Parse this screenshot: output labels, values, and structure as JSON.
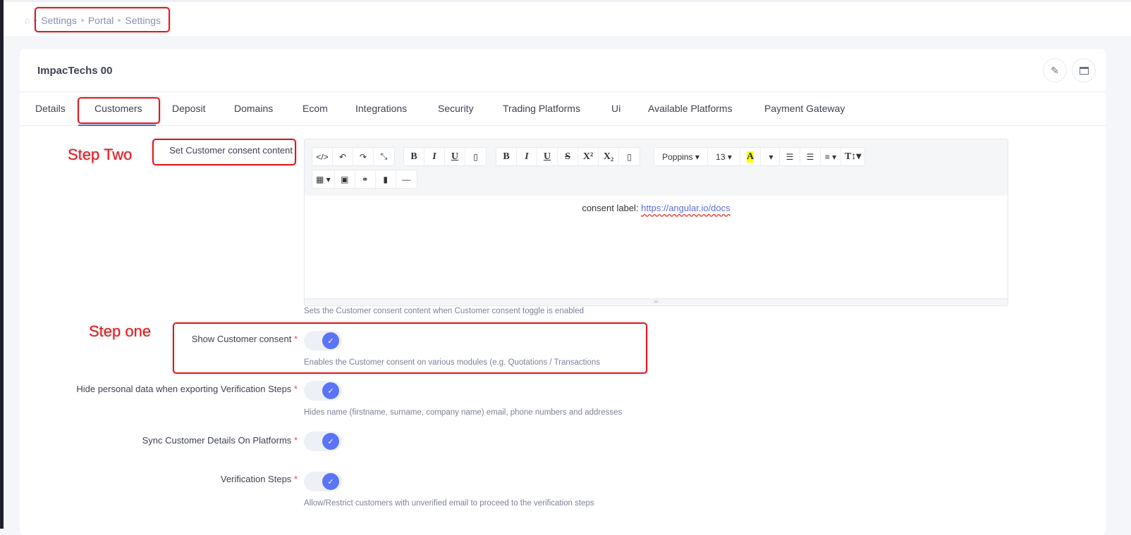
{
  "breadcrumb": [
    "Settings",
    "Portal",
    "Settings"
  ],
  "title": "ImpacTechs 00",
  "tabs": [
    "Details",
    "Customers",
    "Deposit",
    "Domains",
    "Ecom",
    "Integrations",
    "Security",
    "Trading Platforms",
    "Ui",
    "Available Platforms",
    "Payment Gateway"
  ],
  "active_tab": "Customers",
  "annotations": {
    "step_two": "Step Two",
    "step_one": "Step one"
  },
  "editor": {
    "label": "Set Customer consent content",
    "font": "Poppins",
    "size": "13",
    "content_prefix": "consent label: ",
    "content_link": "https://angular.io/docs",
    "help": "Sets the Customer consent content when Customer consent toggle is enabled"
  },
  "settings": [
    {
      "label": "Show Customer consent",
      "enabled": true,
      "help": "Enables the Customer consent on various modules (e.g. Quotations / Transactions"
    },
    {
      "label": "Hide personal data when exporting Verification Steps",
      "enabled": true,
      "help": "Hides name (firstname, surname, company name) email, phone numbers and addresses"
    },
    {
      "label": "Sync Customer Details On Platforms",
      "enabled": true,
      "help": ""
    },
    {
      "label": "Verification Steps",
      "enabled": true,
      "help": "Allow/Restrict customers with unverified email to proceed to the verification steps"
    }
  ],
  "required_mark": "*",
  "colors": {
    "accent": "#5b74f5",
    "annotation": "#e8141b"
  }
}
